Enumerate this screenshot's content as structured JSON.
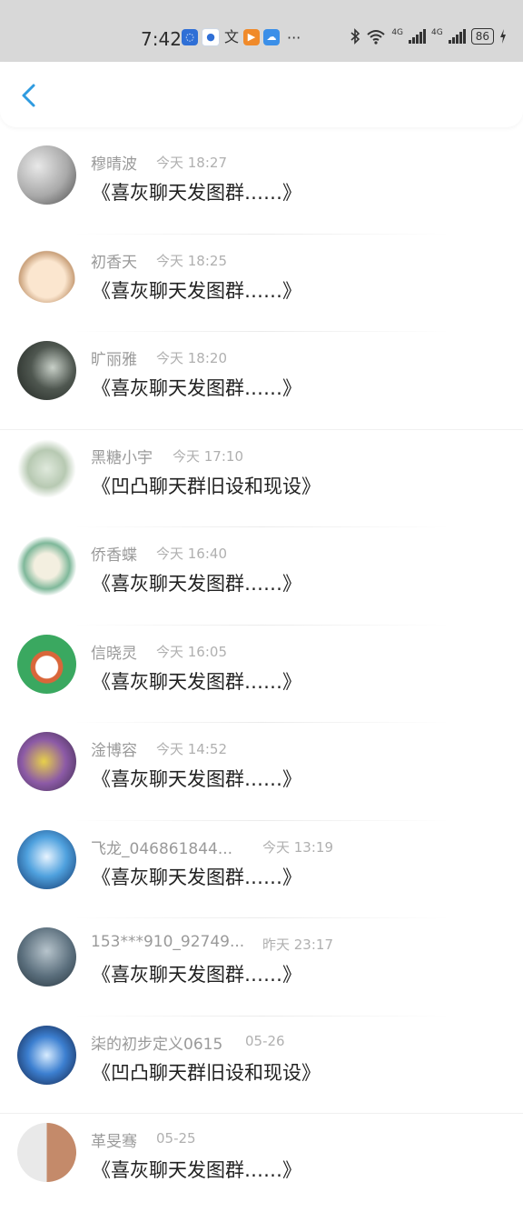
{
  "status": {
    "time": "7:42",
    "more": "···",
    "net1": "4G",
    "net2": "4G",
    "battery": "86"
  },
  "colors": {
    "accent": "#2f9be0",
    "name": "#9a9a9a",
    "time": "#b0b0b0",
    "message": "#222222"
  },
  "header": {
    "back_icon": "chevron-left-icon"
  },
  "messages": [
    {
      "name": "穆晴波",
      "time": "今天 18:27",
      "text": "《喜灰聊天发图群……》"
    },
    {
      "name": "初香天",
      "time": "今天 18:25",
      "text": "《喜灰聊天发图群……》"
    },
    {
      "name": "旷丽雅",
      "time": "今天 18:20",
      "text": "《喜灰聊天发图群……》"
    },
    {
      "name": "黑糖小宇",
      "time": "今天 17:10",
      "text": "《凹凸聊天群旧设和现设》"
    },
    {
      "name": "侨香蝶",
      "time": "今天 16:40",
      "text": "《喜灰聊天发图群……》"
    },
    {
      "name": "信晓灵",
      "time": "今天 16:05",
      "text": "《喜灰聊天发图群……》"
    },
    {
      "name": "淦博容",
      "time": "今天 14:52",
      "text": "《喜灰聊天发图群……》"
    },
    {
      "name": "飞龙_046861844...",
      "time": "今天 13:19",
      "text": "《喜灰聊天发图群……》"
    },
    {
      "name": "153***910_92749...",
      "time": "昨天 23:17",
      "text": "《喜灰聊天发图群……》"
    },
    {
      "name": "柒的初步定义0615",
      "time": "05-26",
      "text": "《凹凸聊天群旧设和现设》"
    },
    {
      "name": "革旻骞",
      "time": "05-25",
      "text": "《喜灰聊天发图群……》"
    }
  ]
}
